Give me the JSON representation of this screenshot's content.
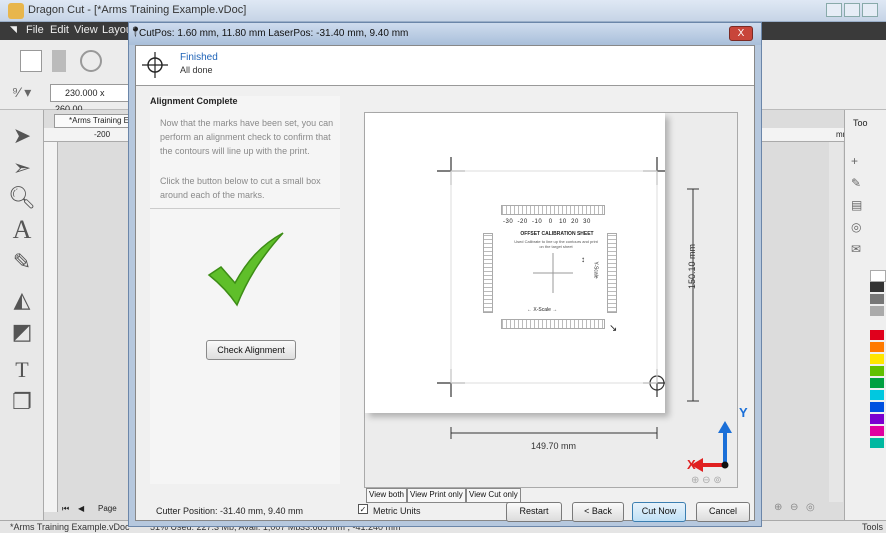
{
  "app": {
    "title": "Dragon Cut - [*Arms Training Example.vDoc]",
    "menu": [
      "File",
      "Edit",
      "View",
      "Layout"
    ],
    "size_field": "230.000 x 260.00",
    "doc_tab": "*Arms Training E",
    "ruler_label": "-200",
    "right_tab": "Too",
    "right_ruler": "mm"
  },
  "status_bar": {
    "file": "*Arms Training Example.vDoc",
    "memory": "51%  Used: 227.3 Mb, Avail: 1,007 Mb",
    "coords": "33.685 mm , -41.240 mm",
    "page_label": "Page",
    "tools_label": "Tools"
  },
  "dialog": {
    "title": "CutPos: 1.60 mm, 11.80 mm  LaserPos: -31.40 mm, 9.40 mm",
    "status_title": "Finished",
    "status_sub": "All done",
    "section_title": "Alignment Complete",
    "description_1": "Now that the marks have been set, you can perform an alignment check to confirm that the contours will line up with the print.",
    "description_2": "Click the button below to cut a small box around each of the marks.",
    "check_button": "Check Alignment",
    "preview": {
      "width_label": "149.70 mm",
      "height_label": "150.10 mm",
      "sheet_title": "OFFSET CALIBRATION SHEET",
      "sheet_sub": "Used Calibrate to line up the contours and print on the target sheet",
      "x_scale": "X-Scale",
      "y_scale": "Y-Scale",
      "ticks": [
        "-30",
        "-20",
        "-10",
        "0",
        "10",
        "20",
        "30"
      ],
      "axis_x": "X",
      "axis_y": "Y"
    },
    "view_tabs": [
      "View both",
      "View Print only",
      "View Cut only"
    ],
    "cutter_position": "Cutter Position: -31.40 mm, 9.40 mm",
    "metric_units": "Metric Units",
    "metric_checked": true,
    "buttons": {
      "restart": "Restart",
      "back": "< Back",
      "cut_now": "Cut Now",
      "cancel": "Cancel"
    },
    "close_label": "X"
  },
  "colors": {
    "accent": "#1e63b8",
    "check_green": "#5fbf2a",
    "axis_red": "#e02020",
    "axis_blue": "#1a6fd8"
  }
}
